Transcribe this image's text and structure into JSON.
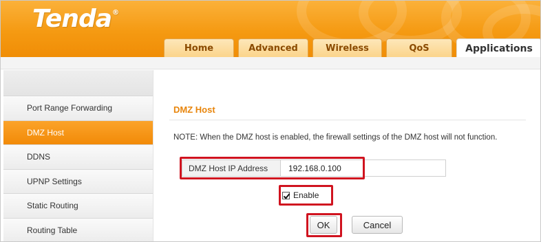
{
  "brand": {
    "logo_text": "Tenda",
    "registered_mark": "®"
  },
  "tabs": [
    {
      "label": "Home",
      "active": false
    },
    {
      "label": "Advanced",
      "active": false
    },
    {
      "label": "Wireless",
      "active": false
    },
    {
      "label": "QoS",
      "active": false
    },
    {
      "label": "Applications",
      "active": true
    }
  ],
  "sidebar": {
    "items": [
      {
        "label": "Port Range Forwarding",
        "active": false
      },
      {
        "label": "DMZ Host",
        "active": true
      },
      {
        "label": "DDNS",
        "active": false
      },
      {
        "label": "UPNP Settings",
        "active": false
      },
      {
        "label": "Static Routing",
        "active": false
      },
      {
        "label": "Routing Table",
        "active": false
      }
    ]
  },
  "main": {
    "title": "DMZ Host",
    "note": "NOTE: When the DMZ host is enabled, the firewall settings of the DMZ host will not function.",
    "ip_label": "DMZ Host IP Address",
    "ip_value": "192.168.0.100",
    "enable_label": "Enable",
    "enable_checked": true,
    "ok_label": "OK",
    "cancel_label": "Cancel"
  },
  "colors": {
    "brand_orange": "#f59a12",
    "title_orange": "#e8850b",
    "highlight_red": "#d0131f"
  }
}
